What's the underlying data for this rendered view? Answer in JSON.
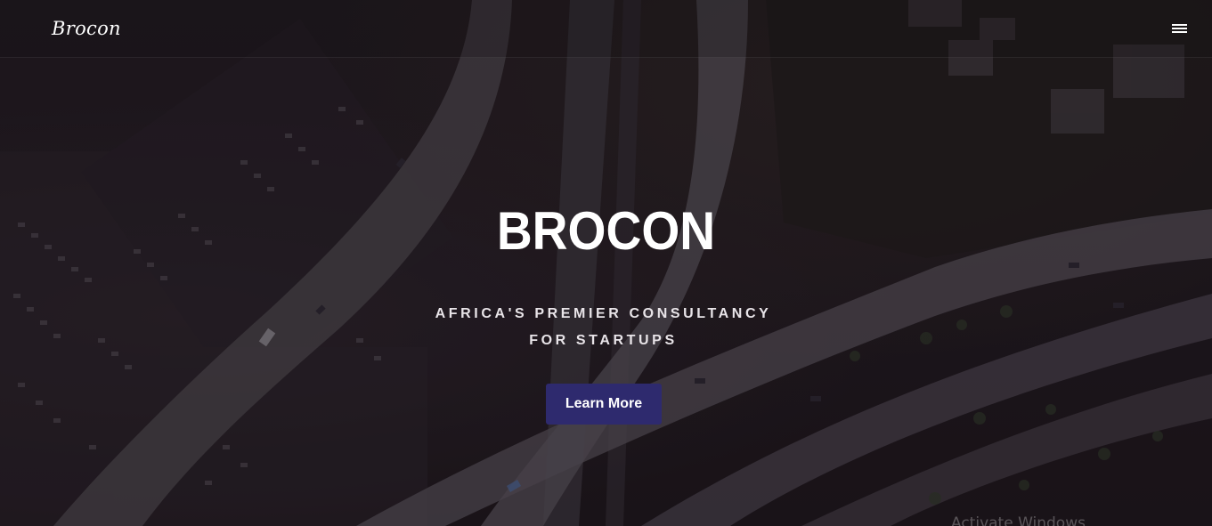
{
  "navbar": {
    "brand": "Brocon",
    "menu_icon": "hamburger-menu-icon"
  },
  "hero": {
    "title": "BROCON",
    "subtitle_line1": "AFRICA'S PREMIER CONSULTANCY",
    "subtitle_line2": "FOR STARTUPS",
    "cta_label": "Learn More",
    "background_image": "aerial-highway-interchange-photo"
  },
  "system": {
    "watermark": "Activate Windows"
  },
  "colors": {
    "cta_background": "#2e2a6e",
    "text_primary": "#ffffff",
    "overlay": "#1e181d"
  }
}
